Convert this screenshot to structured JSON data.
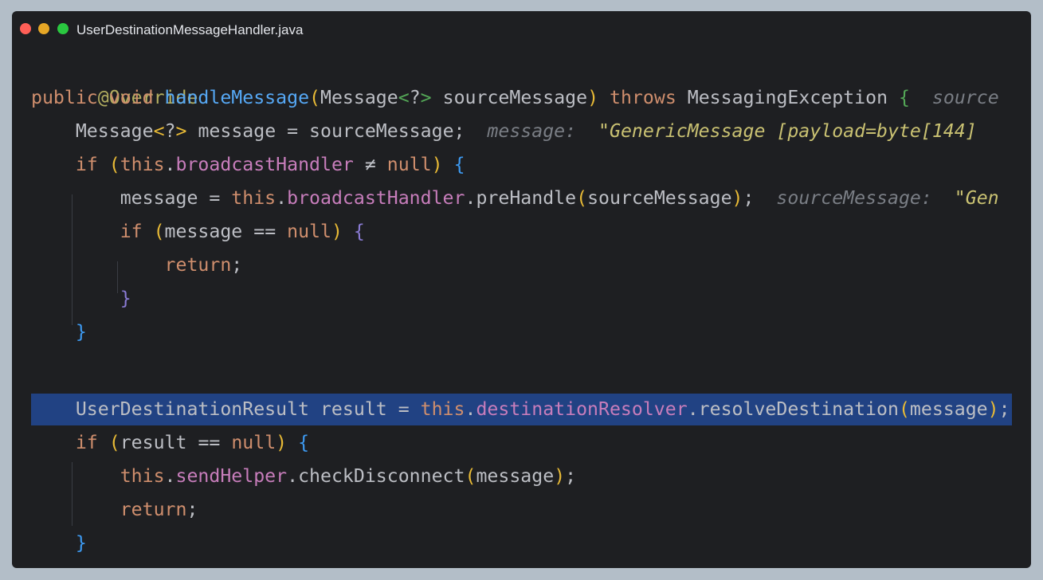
{
  "window": {
    "title": "UserDestinationMessageHandler.java"
  },
  "code": {
    "l1_annotation": "@Override",
    "l2_public": "public",
    "l2_void": "void",
    "l2_method": "handleMessage",
    "l2_param_type": "Message",
    "l2_generic": "?",
    "l2_param_name": "sourceMessage",
    "l2_throws": "throws",
    "l2_exception": "MessagingException",
    "l2_hint": "source",
    "l3_type": "Message",
    "l3_rest": " message = sourceMessage;",
    "l3_hint_label": "message:",
    "l3_hint_value": "\"GenericMessage [payload=byte[144]",
    "l4_if": "if",
    "l4_this": "this",
    "l4_field": "broadcastHandler",
    "l4_neq": "≠",
    "l4_null": "null",
    "l5_lhs": "message = ",
    "l5_this": "this",
    "l5_field": "broadcastHandler",
    "l5_method": ".preHandle",
    "l5_arg": "sourceMessage",
    "l5_hint_label": "sourceMessage:",
    "l5_hint_value": "\"Gen",
    "l6_if": "if",
    "l6_var": "message",
    "l6_eq": "==",
    "l6_null": "null",
    "l7_return": "return",
    "l10_type": "UserDestinationResult",
    "l10_rest": " result = ",
    "l10_this": "this",
    "l10_field": "destinationResolver",
    "l10_method": ".resolveDestination",
    "l10_arg": "message",
    "l11_if": "if",
    "l11_var": "result",
    "l11_eq": "==",
    "l11_null": "null",
    "l12_this": "this",
    "l12_field": "sendHelper",
    "l12_method": ".checkDisconnect",
    "l12_arg": "message",
    "l13_return": "return"
  },
  "colors": {
    "background": "#1e1f22",
    "keyword": "#cf8e6d",
    "field": "#c77dbb",
    "method_decl": "#56a8f5",
    "annotation": "#b3ae60",
    "hint": "#7a7e85",
    "string": "#c9c172",
    "selection": "#214283"
  }
}
